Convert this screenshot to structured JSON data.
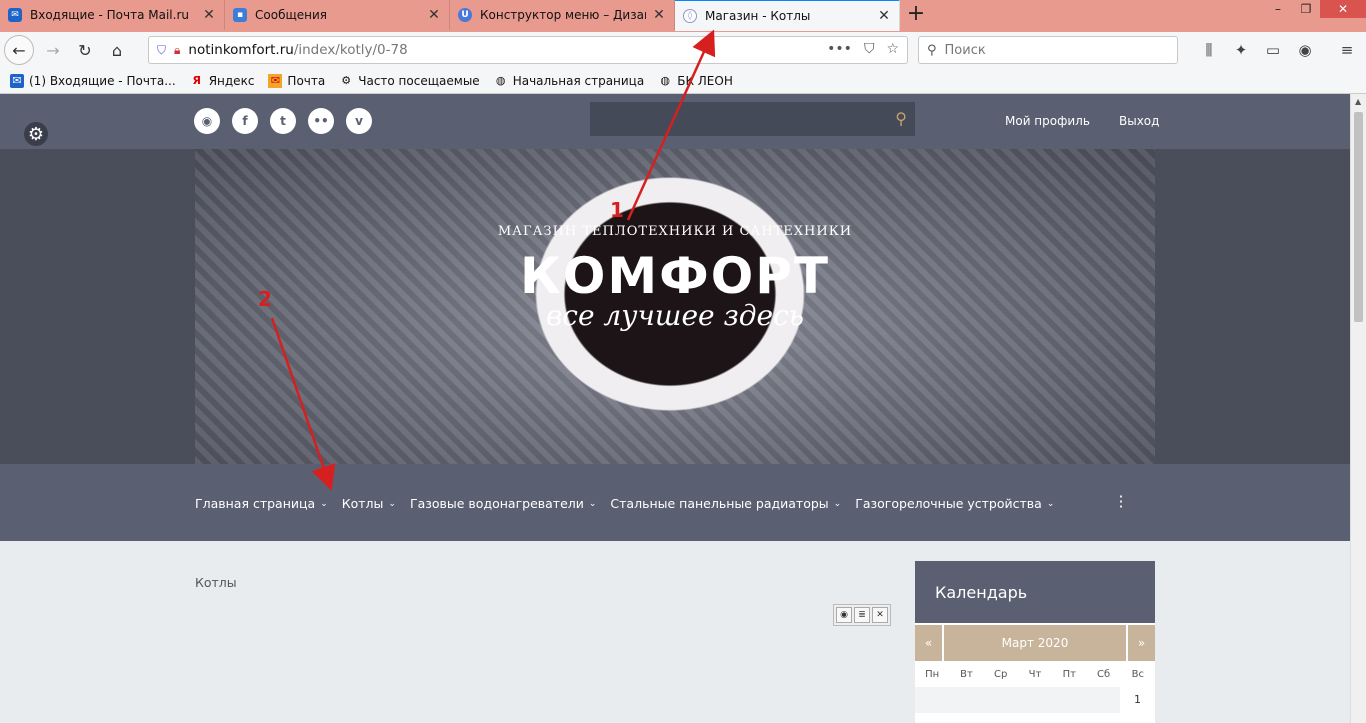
{
  "browser": {
    "tabs": [
      {
        "label": "Входящие - Почта Mail.ru",
        "icon": "mail-icon",
        "color": "#1e64c8"
      },
      {
        "label": "Сообщения",
        "icon": "chat-icon",
        "color": "#3b7ed9"
      },
      {
        "label": "Конструктор меню – Дизайн -",
        "icon": "ucoz-icon",
        "color": "#4a78d8"
      },
      {
        "label": "Магазин - Котлы",
        "icon": "site-icon",
        "color": "#8899cc"
      }
    ],
    "url_domain": "notinkomfort.ru",
    "url_path": "/index/kotly/0-78",
    "search_placeholder": "Поиск",
    "bookmarks": [
      {
        "label": "(1) Входящие - Почта...",
        "icon": "mail-icon"
      },
      {
        "label": "Яндекс",
        "icon": "yandex-icon"
      },
      {
        "label": "Почта",
        "icon": "mail-envelope-icon"
      },
      {
        "label": "Часто посещаемые",
        "icon": "gear-icon"
      },
      {
        "label": "Начальная страница",
        "icon": "globe-icon"
      },
      {
        "label": "БК ЛЕОН",
        "icon": "globe-icon"
      }
    ]
  },
  "site": {
    "header": {
      "profile": "Мой профиль",
      "logout": "Выход",
      "social_icons": [
        "rss-icon",
        "facebook-icon",
        "twitter-icon",
        "flickr-icon",
        "vimeo-icon"
      ]
    },
    "hero": {
      "subtitle": "МАГАЗИН ТЕПЛОТЕХНИКИ И САНТЕХНИКИ",
      "title": "КОМФОРТ",
      "slogan": "все лучшее здесь"
    },
    "menu": [
      {
        "label": "Главная страница"
      },
      {
        "label": "Котлы"
      },
      {
        "label": "Газовые водонагреватели"
      },
      {
        "label": "Стальные панельные радиаторы"
      },
      {
        "label": "Газогорелочные устройства"
      }
    ],
    "content": {
      "page_title": "Котлы"
    },
    "calendar": {
      "title": "Календарь",
      "prev": "«",
      "month": "Март 2020",
      "next": "»",
      "weekdays": [
        "Пн",
        "Вт",
        "Ср",
        "Чт",
        "Пт",
        "Сб",
        "Вс"
      ],
      "first_day": "1"
    }
  },
  "annotations": {
    "marker1": "1",
    "marker2": "2",
    "color": "#d62020"
  }
}
